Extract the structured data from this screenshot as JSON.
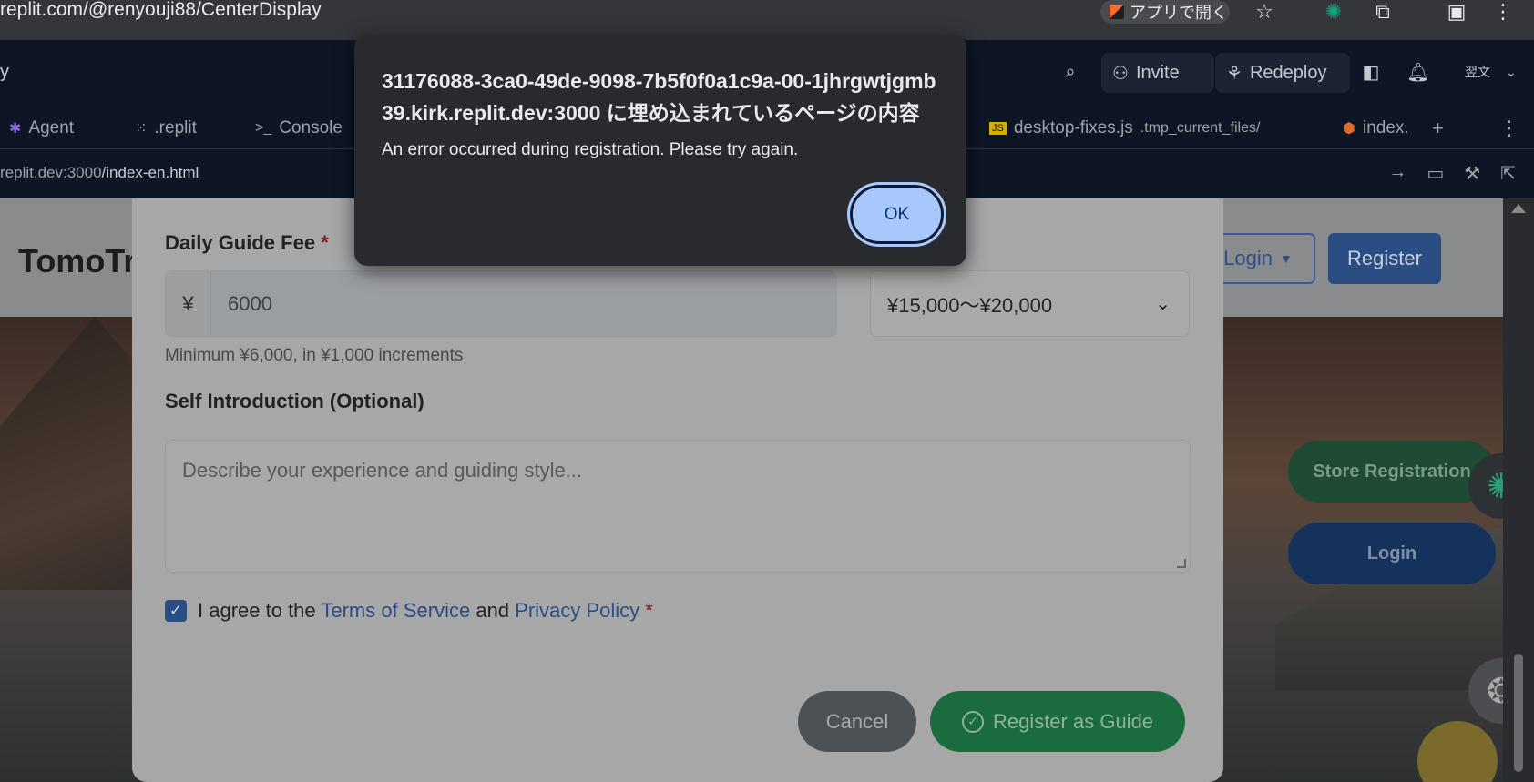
{
  "browser": {
    "url": "replit.com/@renyouji88/CenterDisplay",
    "open_in_app": "アプリで開く"
  },
  "replit": {
    "left_fragment": "y",
    "invite": "Invite",
    "redeploy": "Redeploy",
    "avatar_text": "翌文",
    "tabs": [
      {
        "label": "Agent"
      },
      {
        "label": ".replit"
      },
      {
        "label": "Console"
      },
      {
        "label": "desktop-fixes.js",
        "sub": ".tmp_current_files/"
      },
      {
        "label": "index."
      }
    ],
    "address": "replit.dev:3000/index-en.html",
    "address_prefix": "replit.dev:3000",
    "address_path": "/index-en.html"
  },
  "site": {
    "logo": "TomoTr",
    "nav_login": "Login",
    "nav_register": "Register",
    "store_registration": "Store Registration",
    "hero_login": "Login"
  },
  "form": {
    "fee_label": "Daily Guide Fee",
    "required_mark": "*",
    "currency_prefix": "¥",
    "fee_value": "6000",
    "range_value": "¥15,000〜¥20,000",
    "hint": "Minimum ¥6,000, in ¥1,000 increments",
    "intro_label": "Self Introduction (Optional)",
    "intro_placeholder": "Describe your experience and guiding style...",
    "agree_prefix": "I agree to the",
    "terms": "Terms of Service",
    "and": "and",
    "privacy": "Privacy Policy",
    "cancel": "Cancel",
    "register_guide": "Register as Guide"
  },
  "alert": {
    "title": "31176088-3ca0-49de-9098-7b5f0f0a1c9a-00-1jhrgwtjgmb39.kirk.replit.dev:3000 に埋め込まれているページの内容",
    "message": "An error occurred during registration. Please try again.",
    "ok": "OK"
  }
}
